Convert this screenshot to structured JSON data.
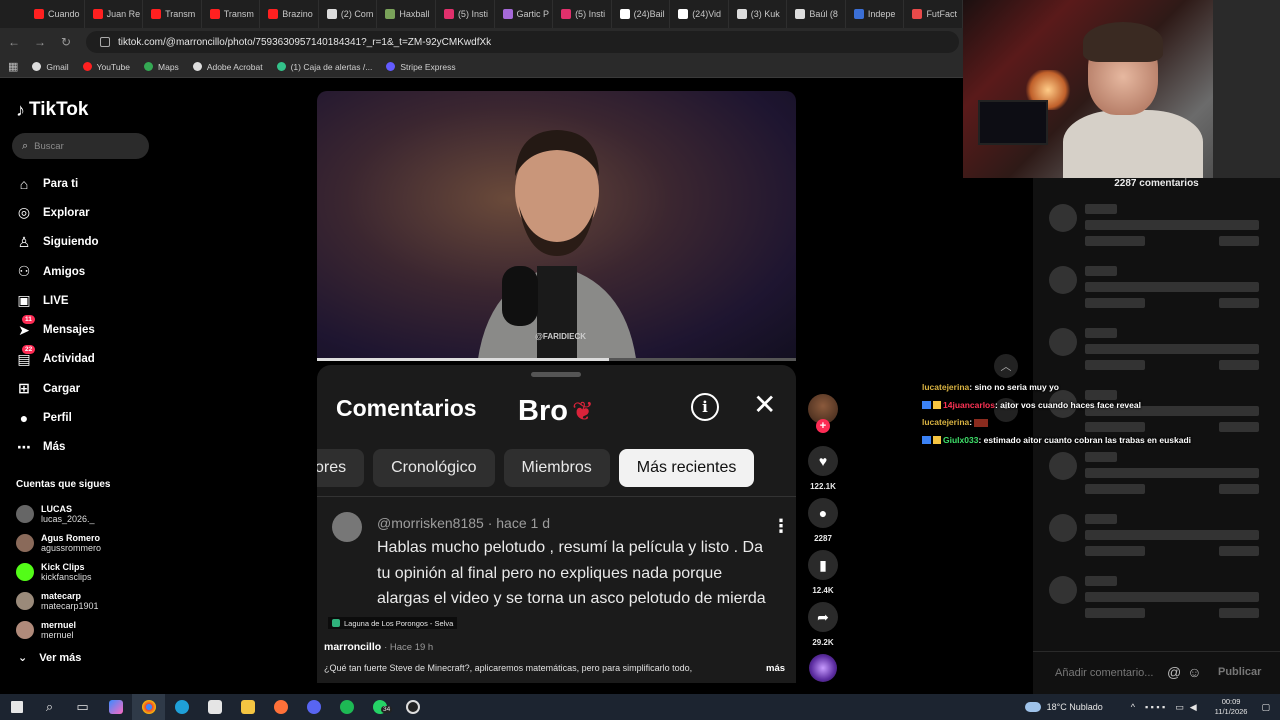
{
  "browser": {
    "tabs": [
      {
        "title": "Cuando",
        "color": "#ff2020"
      },
      {
        "title": "Juan Re",
        "color": "#ff2020"
      },
      {
        "title": "Transm",
        "color": "#ff2020"
      },
      {
        "title": "Transm",
        "color": "#ff2020"
      },
      {
        "title": "Brazino",
        "color": "#ff2020"
      },
      {
        "title": "(2) Com",
        "color": "#dddddd"
      },
      {
        "title": "Haxball",
        "color": "#7aa35a"
      },
      {
        "title": "(5) Insti",
        "color": "#e1306c"
      },
      {
        "title": "Gartic P",
        "color": "#a569d8"
      },
      {
        "title": "(5) Insti",
        "color": "#e1306c"
      },
      {
        "title": "(24)Bail",
        "color": "#ffffff"
      },
      {
        "title": "(24)Vid",
        "color": "#ffffff"
      },
      {
        "title": "(3) Kuk",
        "color": "#dddddd"
      },
      {
        "title": "Baúl (8",
        "color": "#dddddd"
      },
      {
        "title": "Indepe",
        "color": "#3b6fd6"
      },
      {
        "title": "FutFact",
        "color": "#e84a4a"
      }
    ],
    "url": "tiktok.com/@marroncillo/photo/7593630957140184341?_r=1&_t=ZM-92yCMKwdfXk",
    "bookmarks": [
      {
        "label": "Gmail",
        "color": "#dddddd"
      },
      {
        "label": "YouTube",
        "color": "#ff2020"
      },
      {
        "label": "Maps",
        "color": "#34a853"
      },
      {
        "label": "Adobe Acrobat",
        "color": "#dddddd"
      },
      {
        "label": "(1) Caja de alertas /...",
        "color": "#33c28a"
      },
      {
        "label": "Stripe Express",
        "color": "#635bff"
      }
    ]
  },
  "sidebar": {
    "logo": "TikTok",
    "search_placeholder": "Buscar",
    "nav": [
      {
        "label": "Para ti",
        "icon": "home-icon",
        "badge": ""
      },
      {
        "label": "Explorar",
        "icon": "compass-icon",
        "badge": ""
      },
      {
        "label": "Siguiendo",
        "icon": "following-icon",
        "badge": ""
      },
      {
        "label": "Amigos",
        "icon": "friends-icon",
        "badge": ""
      },
      {
        "label": "LIVE",
        "icon": "live-icon",
        "badge": ""
      },
      {
        "label": "Mensajes",
        "icon": "messages-icon",
        "badge": "11"
      },
      {
        "label": "Actividad",
        "icon": "activity-icon",
        "badge": "22"
      },
      {
        "label": "Cargar",
        "icon": "upload-icon",
        "badge": ""
      },
      {
        "label": "Perfil",
        "icon": "profile-icon",
        "badge": ""
      },
      {
        "label": "Más",
        "icon": "more-icon",
        "badge": ""
      }
    ],
    "following_title": "Cuentas que sigues",
    "following": [
      {
        "name": "LUCAS",
        "handle": "lucas_2026._",
        "color": "#666666"
      },
      {
        "name": "Agus Romero",
        "handle": "agussrommero",
        "color": "#8a6a5a"
      },
      {
        "name": "Kick Clips",
        "handle": "kickfansclips",
        "color": "#53fc18"
      },
      {
        "name": "matecarp",
        "handle": "matecarp1901",
        "color": "#9a8a7a"
      },
      {
        "name": "mernuel",
        "handle": "mernuel",
        "color": "#b08a7a"
      }
    ],
    "see_more": "Ver más"
  },
  "video": {
    "watermark": "@FARIDIECK",
    "progress": 0.61
  },
  "comments_panel": {
    "title": "Comentarios",
    "bro_text": "Bro",
    "info_glyph": "i",
    "close_glyph": "✕",
    "chips": [
      {
        "label": "ores",
        "active": false
      },
      {
        "label": "Cronológico",
        "active": false
      },
      {
        "label": "Miembros",
        "active": false
      },
      {
        "label": "Más recientes",
        "active": true
      }
    ],
    "comment": {
      "user": "@morrisken8185",
      "time": "hace 1 d",
      "text": "Hablas mucho pelotudo , resumí la película y listo . Da tu opinión al final pero no expliques nada porque alargas el video y se torna un asco pelotudo de mierda"
    }
  },
  "post": {
    "location": "Laguna de Los Porongos - Selva",
    "author": "marroncillo",
    "time": "· Hace 19 h",
    "caption": "¿Qué tan fuerte Steve de Minecraft?, aplicaremos matemáticas, pero para simplificarlo todo,",
    "more": "más"
  },
  "actions": {
    "likes": "122.1K",
    "comments": "2287",
    "saves": "12.4K",
    "shares": "29.2K"
  },
  "right_pane": {
    "count_title": "2287 comentarios",
    "add_placeholder": "Añadir comentario...",
    "publish": "Publicar"
  },
  "chat": [
    {
      "user": "lucatejerina",
      "msg": ": sino no seria muy yo",
      "badges": false,
      "color": "#d9b342"
    },
    {
      "user": "14juancarlos",
      "msg": ": aitor vos cuando haces face reveal",
      "badges": true,
      "color": "#ff3355"
    },
    {
      "user": "lucatejerina",
      "msg": ":",
      "badges": false,
      "color": "#d9b342"
    },
    {
      "user": "Giulx033",
      "msg": ": estimado aitor cuanto cobran las trabas en euskadi",
      "badges": true,
      "color": "#3fe06a"
    }
  ],
  "taskbar": {
    "weather": "18°C  Nublado",
    "time": "00:09",
    "date": "11/1/2026",
    "whatsapp_badge": "34"
  }
}
